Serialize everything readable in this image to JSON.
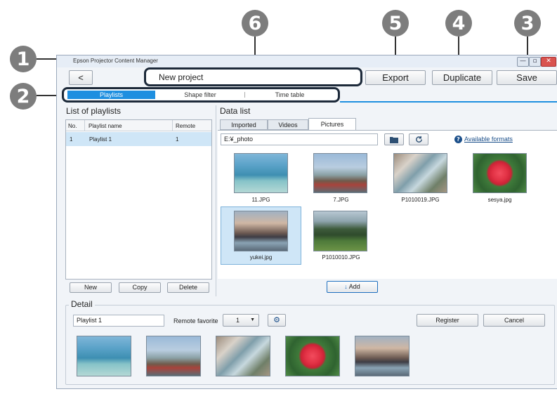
{
  "callouts": [
    "1",
    "2",
    "3",
    "4",
    "5",
    "6"
  ],
  "window": {
    "title": "Epson Projector Content Manager",
    "minimize": "—",
    "maximize": "▫",
    "close": "✕"
  },
  "toolbar": {
    "back_icon": "chevron-left-icon",
    "back_label": "<",
    "project_name": "New project",
    "export_label": "Export",
    "duplicate_label": "Duplicate",
    "save_label": "Save"
  },
  "mode_tabs": [
    {
      "label": "Playlists",
      "selected": true
    },
    {
      "label": "Shape filter",
      "selected": false
    },
    {
      "label": "Time table",
      "selected": false
    }
  ],
  "playlists_panel": {
    "title": "List of playlists",
    "columns": [
      "No.",
      "Playlist name",
      "Remote"
    ],
    "rows": [
      {
        "no": "1",
        "name": "Playlist 1",
        "remote": "1"
      }
    ],
    "buttons": {
      "new": "New",
      "copy": "Copy",
      "delete": "Delete"
    }
  },
  "data_list": {
    "title": "Data list",
    "tabs": [
      {
        "label": "Imported",
        "selected": false
      },
      {
        "label": "Videos",
        "selected": false
      },
      {
        "label": "Pictures",
        "selected": true
      }
    ],
    "path": "E:¥_photo",
    "folder_icon": "folder-icon",
    "refresh_icon": "refresh-icon",
    "help_icon": "help-icon",
    "help_text": "?",
    "formats_link": "Available formats",
    "items": [
      {
        "caption": "11.JPG",
        "image": "sea"
      },
      {
        "caption": "7.JPG",
        "image": "fuji"
      },
      {
        "caption": "P1010019.JPG",
        "image": "waterfall"
      },
      {
        "caption": "sesya.jpg",
        "image": "flower"
      },
      {
        "caption": "yukei.jpg",
        "image": "sunset",
        "selected": true
      },
      {
        "caption": "P1010010.JPG",
        "image": "tree"
      }
    ],
    "add_label": "Add",
    "add_icon": "arrow-down-icon"
  },
  "detail": {
    "title": "Detail",
    "playlist_name": "Playlist 1",
    "remote_favorite_label": "Remote favorite",
    "remote_favorite_value": "1",
    "settings_icon": "gear-icon",
    "register_label": "Register",
    "cancel_label": "Cancel",
    "thumbnails": [
      "sea",
      "fuji",
      "waterfall",
      "flower",
      "sunset"
    ]
  },
  "colors": {
    "accent": "#1e8fe0",
    "highlight": "#cfe6f7",
    "frame": "#1d2a3a",
    "callout": "#7d7d7d"
  }
}
